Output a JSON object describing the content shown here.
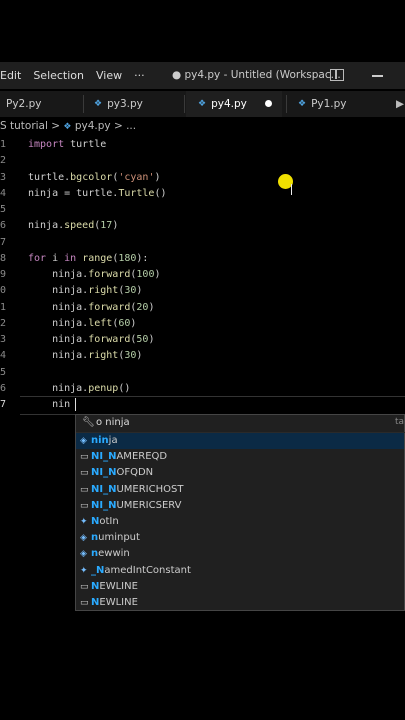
{
  "titlebar": {
    "menus": [
      "Edit",
      "Selection",
      "View",
      "···"
    ],
    "window_title": "● py4.py - Untitled (Workspac..."
  },
  "tabs": [
    {
      "label": "Py2.py"
    },
    {
      "label": "py3.py"
    },
    {
      "label": "py4.py",
      "active": true,
      "modified": true
    },
    {
      "label": "Py1.py"
    }
  ],
  "breadcrumb": {
    "folder": "S tutorial",
    "sep1": ">",
    "file": "py4.py",
    "sep2": "> ..."
  },
  "editor": {
    "lines": [
      {
        "n": "1",
        "text": "import turtle"
      },
      {
        "n": "2",
        "text": ""
      },
      {
        "n": "3",
        "text": "turtle.bgcolor('cyan')"
      },
      {
        "n": "4",
        "text": "ninja = turtle.Turtle()"
      },
      {
        "n": "5",
        "text": ""
      },
      {
        "n": "6",
        "text": "ninja.speed(17)"
      },
      {
        "n": "7",
        "text": ""
      },
      {
        "n": "8",
        "text": "for i in range(180):"
      },
      {
        "n": "9",
        "text": "    ninja.forward(100)"
      },
      {
        "n": "0",
        "text": "    ninja.right(30)"
      },
      {
        "n": "1",
        "text": "    ninja.forward(20)"
      },
      {
        "n": "2",
        "text": "    ninja.left(60)"
      },
      {
        "n": "3",
        "text": "    ninja.forward(50)"
      },
      {
        "n": "4",
        "text": "    ninja.right(30)"
      },
      {
        "n": "5",
        "text": ""
      },
      {
        "n": "6",
        "text": "    ninja.penup()"
      },
      {
        "n": "7",
        "text": "    nin"
      }
    ]
  },
  "suggest": {
    "header": "o ninja",
    "header_right": "ta",
    "items": [
      {
        "match": "nin",
        "rest": "ja",
        "icon": "variable-icon"
      },
      {
        "match": "NI_N",
        "rest": "AMEREQD",
        "icon": "abc-icon"
      },
      {
        "match": "NI_N",
        "rest": "OFQDN",
        "icon": "abc-icon"
      },
      {
        "match": "NI_N",
        "rest": "UMERICHOST",
        "icon": "abc-icon"
      },
      {
        "match": "NI_N",
        "rest": "UMERICSERV",
        "icon": "abc-icon"
      },
      {
        "match": "N",
        "rest": "otIn",
        "icon": "class-icon"
      },
      {
        "match": "n",
        "rest": "uminput",
        "icon": "variable-icon"
      },
      {
        "match": "n",
        "rest": "ewwin",
        "icon": "variable-icon"
      },
      {
        "match": "_N",
        "rest": "amedIntConstant",
        "icon": "class-icon"
      },
      {
        "match": "N",
        "rest": "EWLINE",
        "icon": "abc-icon"
      },
      {
        "match": "N",
        "rest": "EWLINE",
        "icon": "abc-icon"
      }
    ]
  },
  "colors": {
    "accent": "#2aaaff",
    "py_icon": "#4fa3e0",
    "pointer": "#f0e000"
  }
}
